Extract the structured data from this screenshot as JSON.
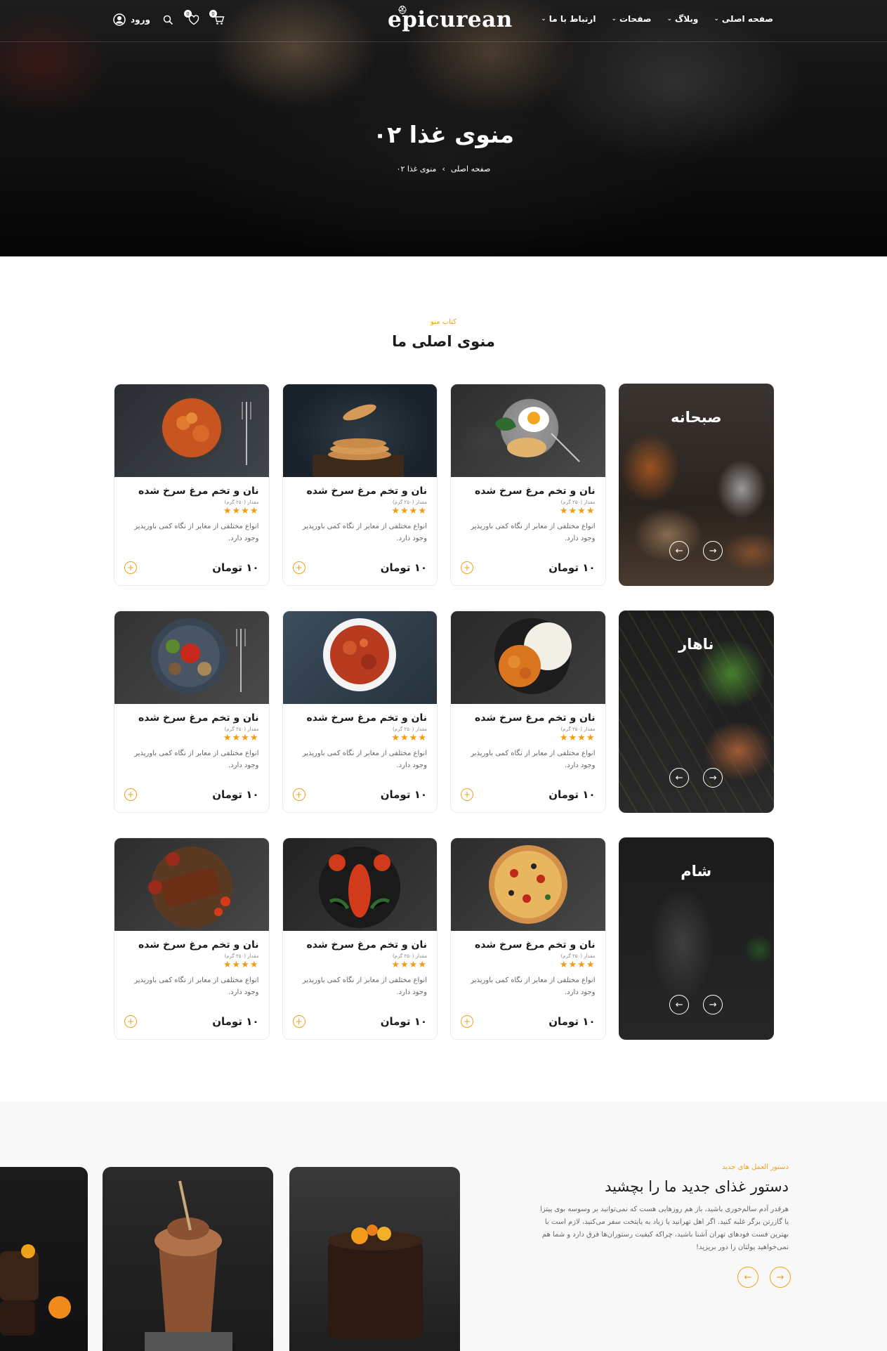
{
  "nav": {
    "menu": [
      {
        "label": "صفحه اصلی",
        "has_dropdown": true
      },
      {
        "label": "وبلاگ",
        "has_dropdown": true
      },
      {
        "label": "صفحات",
        "has_dropdown": true
      },
      {
        "label": "ارتباط با ما",
        "has_dropdown": true
      }
    ],
    "logo": "epicurean",
    "login_label": "ورود",
    "cart_count": "0",
    "wishlist_count": "0"
  },
  "hero": {
    "title": "منوی غذا ۰۲",
    "breadcrumb": [
      "صفحه اصلی",
      "منوی غذا ۰۲"
    ]
  },
  "menu_section": {
    "subtitle": "کتاب منو",
    "title": "منوی اصلی ما"
  },
  "categories": [
    {
      "name": "صبحانه"
    },
    {
      "name": "ناهار"
    },
    {
      "name": "شام"
    }
  ],
  "item_template": {
    "name": "نان و تخم مرغ سرخ شده",
    "quantity": "مقدار (۲۵۰ گرم)",
    "rating": 4,
    "description": "انواع مختلفی از معابر از نگاه کمی باورپذیر وجود دارد.",
    "price": "۱۰ تومان"
  },
  "menu_rows": [
    {
      "items": [
        {
          "name": "نان و تخم مرغ سرخ شده",
          "quantity": "مقدار (۲۵۰ گرم)",
          "description": "انواع مختلفی از معابر از نگاه کمی باورپذیر وجود دارد.",
          "price": "۱۰ تومان",
          "image": "egg-toast"
        },
        {
          "name": "نان و تخم مرغ سرخ شده",
          "quantity": "مقدار (۲۵۰ گرم)",
          "description": "انواع مختلفی از معابر از نگاه کمی باورپذیر وجود دارد.",
          "price": "۱۰ تومان",
          "image": "pancakes"
        },
        {
          "name": "نان و تخم مرغ سرخ شده",
          "quantity": "مقدار (۲۵۰ گرم)",
          "description": "انواع مختلفی از معابر از نگاه کمی باورپذیر وجود دارد.",
          "price": "۱۰ تومان",
          "image": "pasta"
        }
      ]
    },
    {
      "items": [
        {
          "name": "نان و تخم مرغ سرخ شده",
          "quantity": "مقدار (۲۵۰ گرم)",
          "description": "انواع مختلفی از معابر از نگاه کمی باورپذیر وجود دارد.",
          "price": "۱۰ تومان",
          "image": "curry-rice"
        },
        {
          "name": "نان و تخم مرغ سرخ شده",
          "quantity": "مقدار (۲۵۰ گرم)",
          "description": "انواع مختلفی از معابر از نگاه کمی باورپذیر وجود دارد.",
          "price": "۱۰ تومان",
          "image": "stew"
        },
        {
          "name": "نان و تخم مرغ سرخ شده",
          "quantity": "مقدار (۲۵۰ گرم)",
          "description": "انواع مختلفی از معابر از نگاه کمی باورپذیر وجود دارد.",
          "price": "۱۰ تومان",
          "image": "grilled-veg"
        }
      ]
    },
    {
      "items": [
        {
          "name": "نان و تخم مرغ سرخ شده",
          "quantity": "مقدار (۲۵۰ گرم)",
          "description": "انواع مختلفی از معابر از نگاه کمی باورپذیر وجود دارد.",
          "price": "۱۰ تومان",
          "image": "pizza"
        },
        {
          "name": "نان و تخم مرغ سرخ شده",
          "quantity": "مقدار (۲۵۰ گرم)",
          "description": "انواع مختلفی از معابر از نگاه کمی باورپذیر وجود دارد.",
          "price": "۱۰ تومان",
          "image": "lobster"
        },
        {
          "name": "نان و تخم مرغ سرخ شده",
          "quantity": "مقدار (۲۵۰ گرم)",
          "description": "انواع مختلفی از معابر از نگاه کمی باورپذیر وجود دارد.",
          "price": "۱۰ تومان",
          "image": "ribs"
        }
      ]
    }
  ],
  "recipe_section": {
    "subtitle": "دستور العمل های جدید",
    "title": "دستور غذای جدید ما را بچشید",
    "description": "هرقدر آدم سالم‌خوری باشید، باز هم روزهایی هست که نمی‌توانید بر وسوسه بوی پیتزا یا گازرتن برگر غلبه کنید. اگر اهل تهرانید یا زیاد به پایتخت سفر می‌کنید، لازم است با بهترین فست فودهای تهران آشنا باشید، چراکه کیفیت رستوران‌ها فرق دارد و شما هم نمی‌خواهید پولتان را دور بریزید!",
    "images": [
      "chocolate-cake",
      "chocolate-milkshake",
      "brownie-tangerine"
    ]
  },
  "colors": {
    "accent": "#f0a21a",
    "star": "#f39c12",
    "dark": "#1b1b1b"
  }
}
